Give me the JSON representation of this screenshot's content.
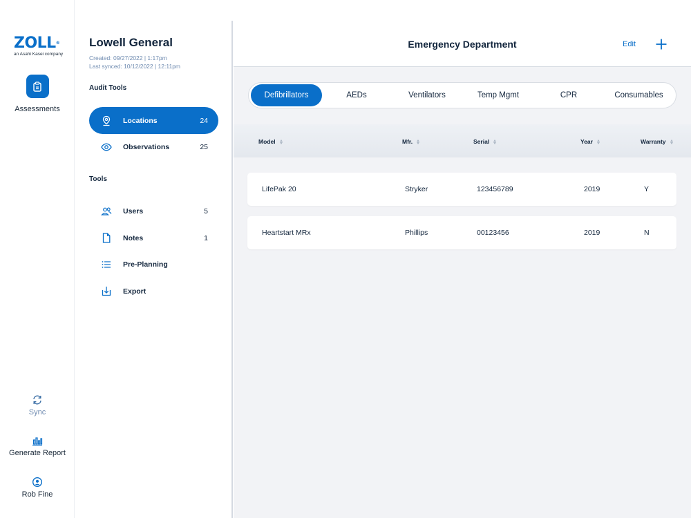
{
  "brand": {
    "logo_text": "ZOLL",
    "logo_tagline": "an Asahi Kasei company",
    "accent": "#0a6fc9"
  },
  "rail": {
    "assessments_label": "Assessments",
    "sync_label": "Sync",
    "report_label": "Generate Report",
    "user_label": "Rob Fine"
  },
  "panel": {
    "title": "Lowell General",
    "created": "Created: 09/27/2022 | 1:17pm",
    "last_synced": "Last synced: 10/12/2022 | 12:11pm",
    "audit_tools_heading": "Audit Tools",
    "tools_heading": "Tools",
    "audit_items": [
      {
        "label": "Locations",
        "count": "24",
        "icon": "map-pin-icon",
        "active": true
      },
      {
        "label": "Observations",
        "count": "25",
        "icon": "eye-icon",
        "active": false
      }
    ],
    "tool_items": [
      {
        "label": "Users",
        "count": "5",
        "icon": "users-icon"
      },
      {
        "label": "Notes",
        "count": "1",
        "icon": "document-icon"
      },
      {
        "label": "Pre-Planning",
        "count": "",
        "icon": "list-icon"
      },
      {
        "label": "Export",
        "count": "",
        "icon": "download-icon"
      }
    ]
  },
  "header": {
    "title": "Emergency Department",
    "edit_label": "Edit",
    "add_icon": "plus-icon"
  },
  "tabs": [
    {
      "label": "Defibrillators",
      "active": true
    },
    {
      "label": "AEDs",
      "active": false
    },
    {
      "label": "Ventilators",
      "active": false
    },
    {
      "label": "Temp Mgmt",
      "active": false
    },
    {
      "label": "CPR",
      "active": false
    },
    {
      "label": "Consumables",
      "active": false
    }
  ],
  "table": {
    "columns": [
      "Model",
      "Mfr.",
      "Serial",
      "Year",
      "Warranty"
    ],
    "rows": [
      [
        "LifePak 20",
        "Stryker",
        "123456789",
        "2019",
        "Y"
      ],
      [
        "Heartstart MRx",
        "Phillips",
        "00123456",
        "2019",
        "N"
      ]
    ]
  }
}
